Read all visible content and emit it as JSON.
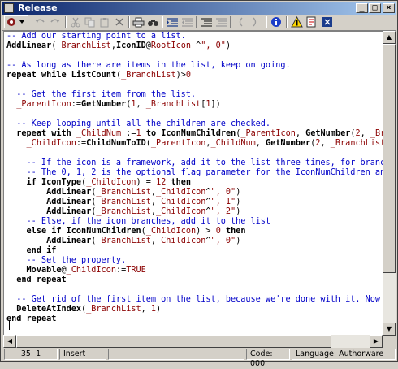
{
  "window": {
    "title": "Release"
  },
  "titlebar_buttons": {
    "minimize": "_",
    "maximize": "□",
    "close": "×"
  },
  "toolbar": {
    "items": [
      {
        "name": "toolbar-menu-button",
        "icon": "script-dropdown-icon"
      },
      {
        "name": "undo-button",
        "icon": "undo-icon"
      },
      {
        "name": "redo-button",
        "icon": "redo-icon"
      },
      {
        "name": "cut-button",
        "icon": "cut-icon"
      },
      {
        "name": "copy-button",
        "icon": "copy-icon"
      },
      {
        "name": "paste-button",
        "icon": "paste-icon"
      },
      {
        "name": "delete-button",
        "icon": "delete-icon"
      },
      {
        "name": "print-button",
        "icon": "print-icon"
      },
      {
        "name": "find-button",
        "icon": "find-icon"
      },
      {
        "name": "indent-button",
        "icon": "indent-icon"
      },
      {
        "name": "outdent-button",
        "icon": "outdent-icon"
      },
      {
        "name": "comment-button",
        "icon": "comment-icon"
      },
      {
        "name": "uncomment-button",
        "icon": "uncomment-icon"
      },
      {
        "name": "bracket-open-button",
        "icon": "bracket-open-icon"
      },
      {
        "name": "bracket-close-button",
        "icon": "bracket-close-icon"
      },
      {
        "name": "info-button",
        "icon": "info-icon"
      },
      {
        "name": "warning-button",
        "icon": "warning-icon"
      },
      {
        "name": "script-button",
        "icon": "script-icon"
      },
      {
        "name": "properties-button",
        "icon": "properties-icon"
      }
    ]
  },
  "editor": {
    "lines": [
      "-- Add our starting point to a list.",
      "AddLinear(_BranchList,IconID@RootIcon ^\", 0\")",
      "",
      "-- As long as there are items in the list, keep on going.",
      "repeat while ListCount(_BranchList)>0",
      "",
      "  -- Get the first item from the list.",
      "  _ParentIcon:=GetNumber(1, _BranchList[1])",
      "",
      "  -- Keep looping until all the children are checked.",
      "  repeat with _ChildNum :=1 to IconNumChildren(_ParentIcon, GetNumber(2, _BranchList[1]))",
      "    _ChildIcon:=ChildNumToID(_ParentIcon,_ChildNum, GetNumber(2, _BranchList[1]))",
      "",
      "    -- If the icon is a framework, add it to the list three times, for branching, entry pa",
      "    -- The 0, 1, 2 is the optional flag parameter for the IconNumChildren and ChildNumToID",
      "    if IconType(_ChildIcon) = 12 then",
      "        AddLinear(_BranchList,_ChildIcon^\", 0\")",
      "        AddLinear(_BranchList,_ChildIcon^\", 1\")",
      "        AddLinear(_BranchList,_ChildIcon^\", 2\")",
      "    -- Else, if the icon branches, add it to the list",
      "    else if IconNumChildren(_ChildIcon) > 0 then",
      "        AddLinear(_BranchList,_ChildIcon^\", 0\")",
      "    end if",
      "    -- Set the property.",
      "    Movable@_ChildIcon:=TRUE",
      "  end repeat",
      "",
      "  -- Get rid of the first item on the list, because we're done with it. Now the second ite",
      "  DeleteAtIndex(_BranchList, 1)",
      "end repeat",
      ""
    ]
  },
  "statusbar": {
    "position": "35: 1",
    "mode": "Insert",
    "code": "Code: 000",
    "language": "Language: Authorware"
  },
  "colors": {
    "comment": "#0000c8",
    "identifier": "#8b0000",
    "titlebar_start": "#0a246a",
    "titlebar_end": "#a6caf0",
    "chrome": "#d4d0c8"
  }
}
